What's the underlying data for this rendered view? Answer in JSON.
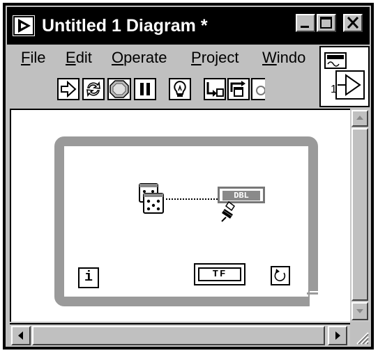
{
  "window": {
    "title": "Untitled 1 Diagram *",
    "icon": "labview-vi-icon"
  },
  "title_buttons": {
    "minimize_icon": "minimize-icon",
    "maximize_icon": "maximize-icon",
    "close_icon": "close-icon"
  },
  "menu": {
    "items": [
      {
        "label": "File",
        "accel": "F",
        "rest": "ile"
      },
      {
        "label": "Edit",
        "accel": "E",
        "rest": "dit"
      },
      {
        "label": "Operate",
        "accel": "O",
        "rest": "perate"
      },
      {
        "label": "Project",
        "accel": "P",
        "rest": "roject"
      },
      {
        "label": "Window",
        "accel": "W",
        "rest": "indo"
      }
    ]
  },
  "toolbar": {
    "tools": [
      "run-arrow-icon",
      "run-continuous-icon",
      "abort-icon",
      "pause-icon",
      "highlight-execution-icon",
      "step-into-icon",
      "step-over-icon",
      "step-out-icon"
    ]
  },
  "connector_pane": {
    "label": "1"
  },
  "diagram": {
    "iteration_terminal": "i",
    "boolean_constant": "TF",
    "numeric_indicator": "DBL",
    "random_node_icon": "dice-icon",
    "probe_icon": "probe-icon",
    "loop_condition_icon": "loop-condition-icon"
  }
}
